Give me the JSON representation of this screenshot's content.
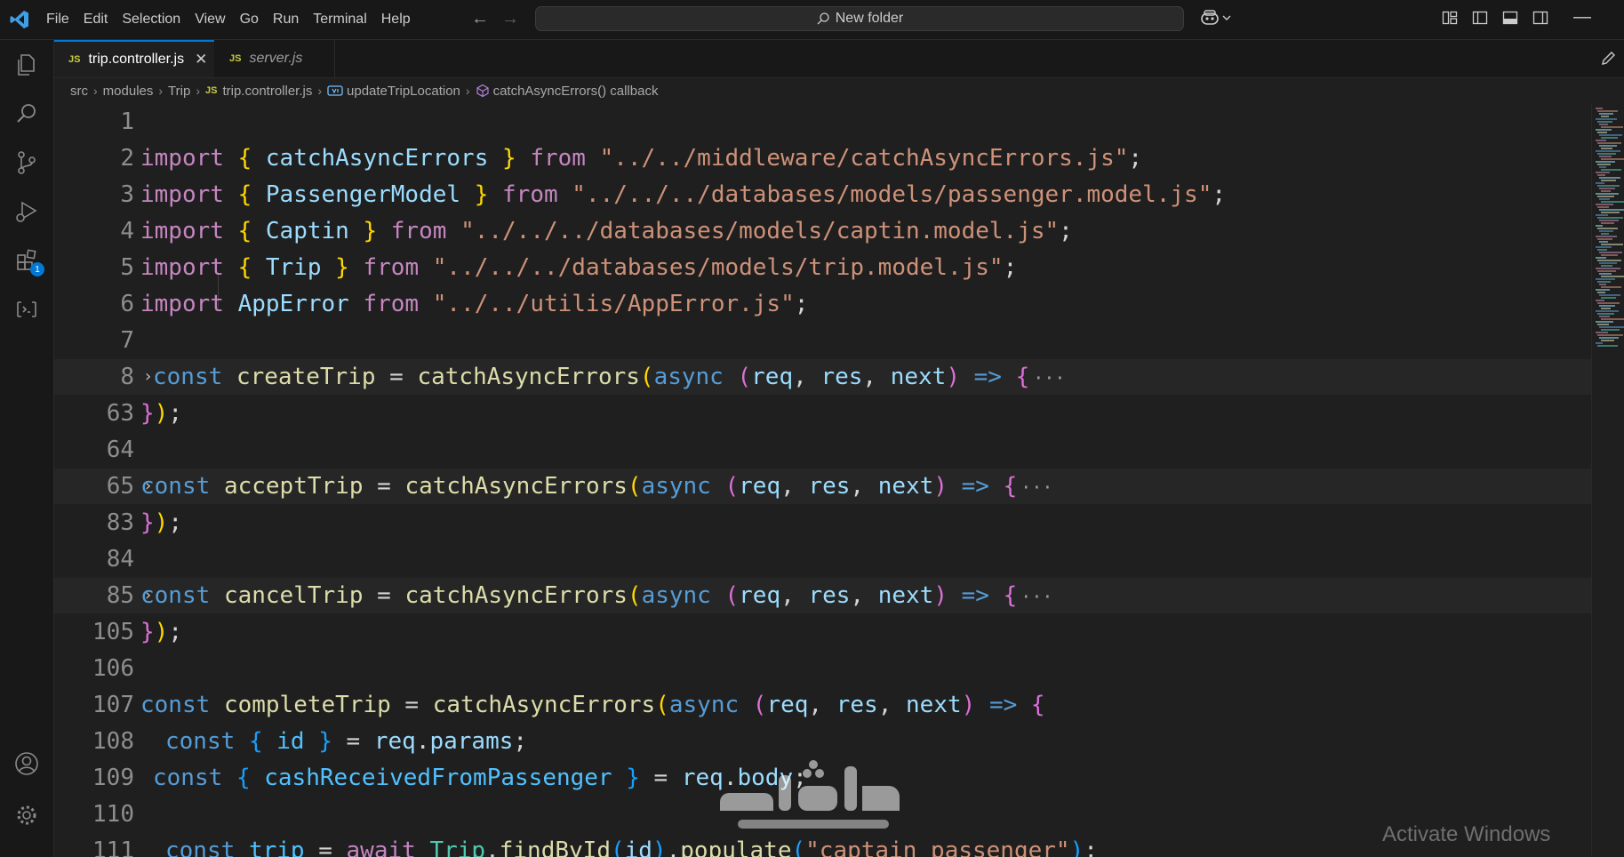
{
  "window": {
    "menu": [
      "File",
      "Edit",
      "Selection",
      "View",
      "Go",
      "Run",
      "Terminal",
      "Help"
    ],
    "command_center": "New folder",
    "minimize_glyph": "—"
  },
  "activity_bar": {
    "items": [
      "explorer-icon",
      "search-icon",
      "source-control-icon",
      "run-debug-icon",
      "extensions-icon",
      "remote-explorer-icon"
    ],
    "extensions_badge": "1",
    "bottom": [
      "accounts-icon",
      "settings-icon"
    ]
  },
  "tabs": [
    {
      "label": "trip.controller.js",
      "badge": "JS",
      "active": true,
      "close": "✕"
    },
    {
      "label": "server.js",
      "badge": "JS",
      "active": false
    }
  ],
  "breadcrumb": {
    "items": [
      "src",
      "modules",
      "Trip",
      "trip.controller.js",
      "updateTripLocation",
      "catchAsyncErrors() callback"
    ],
    "separator": "›",
    "file_badge": "JS"
  },
  "editor": {
    "line_numbers": [
      "1",
      "2",
      "3",
      "4",
      "5",
      "6",
      "7",
      "8",
      "63",
      "64",
      "65",
      "83",
      "84",
      "85",
      "105",
      "106",
      "107",
      "108",
      "109",
      "110",
      "111"
    ],
    "lines": [
      [],
      [
        [
          "kw",
          "import"
        ],
        [
          "pun",
          " "
        ],
        [
          "b1",
          "{"
        ],
        [
          "pun",
          " "
        ],
        [
          "var",
          "catchAsyncErrors"
        ],
        [
          "pun",
          " "
        ],
        [
          "b1",
          "}"
        ],
        [
          "pun",
          " "
        ],
        [
          "kw",
          "from"
        ],
        [
          "pun",
          " "
        ],
        [
          "str",
          "\"../../middleware/catchAsyncErrors.js\""
        ],
        [
          "pun",
          ";"
        ]
      ],
      [
        [
          "kw",
          "import"
        ],
        [
          "pun",
          " "
        ],
        [
          "b1",
          "{"
        ],
        [
          "pun",
          " "
        ],
        [
          "var",
          "PassengerModel"
        ],
        [
          "pun",
          " "
        ],
        [
          "b1",
          "}"
        ],
        [
          "pun",
          " "
        ],
        [
          "kw",
          "from"
        ],
        [
          "pun",
          " "
        ],
        [
          "str",
          "\"../../../databases/models/passenger.model.js\""
        ],
        [
          "pun",
          ";"
        ]
      ],
      [
        [
          "kw",
          "import"
        ],
        [
          "pun",
          " "
        ],
        [
          "b1",
          "{"
        ],
        [
          "pun",
          " "
        ],
        [
          "var",
          "Captin"
        ],
        [
          "pun",
          " "
        ],
        [
          "b1",
          "}"
        ],
        [
          "pun",
          " "
        ],
        [
          "kw",
          "from"
        ],
        [
          "pun",
          " "
        ],
        [
          "str",
          "\"../../../databases/models/captin.model.js\""
        ],
        [
          "pun",
          ";"
        ]
      ],
      [
        [
          "kw",
          "import"
        ],
        [
          "pun",
          " "
        ],
        [
          "b1",
          "{"
        ],
        [
          "pun",
          " "
        ],
        [
          "var",
          "Trip"
        ],
        [
          "pun",
          " "
        ],
        [
          "b1",
          "}"
        ],
        [
          "pun",
          " "
        ],
        [
          "kw",
          "from"
        ],
        [
          "pun",
          " "
        ],
        [
          "str",
          "\"../../../databases/models/trip.model.js\""
        ],
        [
          "pun",
          ";"
        ]
      ],
      [
        [
          "kw",
          "import"
        ],
        [
          "pun",
          " "
        ],
        [
          "var",
          "AppError"
        ],
        [
          "pun",
          " "
        ],
        [
          "kw",
          "from"
        ],
        [
          "pun",
          " "
        ],
        [
          "str",
          "\"../../utilis/AppError.js\""
        ],
        [
          "pun",
          ";"
        ]
      ],
      [],
      [
        [
          "st",
          "const"
        ],
        [
          "pun",
          " "
        ],
        [
          "fn",
          "createTrip"
        ],
        [
          "pun",
          " = "
        ],
        [
          "fn",
          "catchAsyncErrors"
        ],
        [
          "b1",
          "("
        ],
        [
          "st",
          "async"
        ],
        [
          "pun",
          " "
        ],
        [
          "b2",
          "("
        ],
        [
          "var",
          "req"
        ],
        [
          "pun",
          ", "
        ],
        [
          "var",
          "res"
        ],
        [
          "pun",
          ", "
        ],
        [
          "var",
          "next"
        ],
        [
          "b2",
          ")"
        ],
        [
          "pun",
          " "
        ],
        [
          "st",
          "=>"
        ],
        [
          "pun",
          " "
        ],
        [
          "b2",
          "{"
        ]
      ],
      [
        [
          "b2",
          "}"
        ],
        [
          "b1",
          ")"
        ],
        [
          "pun",
          ";"
        ]
      ],
      [],
      [
        [
          "st",
          "const"
        ],
        [
          "pun",
          " "
        ],
        [
          "fn",
          "acceptTrip"
        ],
        [
          "pun",
          " = "
        ],
        [
          "fn",
          "catchAsyncErrors"
        ],
        [
          "b1",
          "("
        ],
        [
          "st",
          "async"
        ],
        [
          "pun",
          " "
        ],
        [
          "b2",
          "("
        ],
        [
          "var",
          "req"
        ],
        [
          "pun",
          ", "
        ],
        [
          "var",
          "res"
        ],
        [
          "pun",
          ", "
        ],
        [
          "var",
          "next"
        ],
        [
          "b2",
          ")"
        ],
        [
          "pun",
          " "
        ],
        [
          "st",
          "=>"
        ],
        [
          "pun",
          " "
        ],
        [
          "b2",
          "{"
        ]
      ],
      [
        [
          "b2",
          "}"
        ],
        [
          "b1",
          ")"
        ],
        [
          "pun",
          ";"
        ]
      ],
      [],
      [
        [
          "st",
          "const"
        ],
        [
          "pun",
          " "
        ],
        [
          "fn",
          "cancelTrip"
        ],
        [
          "pun",
          " = "
        ],
        [
          "fn",
          "catchAsyncErrors"
        ],
        [
          "b1",
          "("
        ],
        [
          "st",
          "async"
        ],
        [
          "pun",
          " "
        ],
        [
          "b2",
          "("
        ],
        [
          "var",
          "req"
        ],
        [
          "pun",
          ", "
        ],
        [
          "var",
          "res"
        ],
        [
          "pun",
          ", "
        ],
        [
          "var",
          "next"
        ],
        [
          "b2",
          ")"
        ],
        [
          "pun",
          " "
        ],
        [
          "st",
          "=>"
        ],
        [
          "pun",
          " "
        ],
        [
          "b2",
          "{"
        ]
      ],
      [
        [
          "b2",
          "}"
        ],
        [
          "b1",
          ")"
        ],
        [
          "pun",
          ";"
        ]
      ],
      [],
      [
        [
          "st",
          "const"
        ],
        [
          "pun",
          " "
        ],
        [
          "fn",
          "completeTrip"
        ],
        [
          "pun",
          " = "
        ],
        [
          "fn",
          "catchAsyncErrors"
        ],
        [
          "b1",
          "("
        ],
        [
          "st",
          "async"
        ],
        [
          "pun",
          " "
        ],
        [
          "b2",
          "("
        ],
        [
          "var",
          "req"
        ],
        [
          "pun",
          ", "
        ],
        [
          "var",
          "res"
        ],
        [
          "pun",
          ", "
        ],
        [
          "var",
          "next"
        ],
        [
          "b2",
          ")"
        ],
        [
          "pun",
          " "
        ],
        [
          "st",
          "=>"
        ],
        [
          "pun",
          " "
        ],
        [
          "b2",
          "{"
        ]
      ],
      [
        [
          "st",
          "const"
        ],
        [
          "pun",
          " "
        ],
        [
          "b3",
          "{"
        ],
        [
          "pun",
          " "
        ],
        [
          "cvar",
          "id"
        ],
        [
          "pun",
          " "
        ],
        [
          "b3",
          "}"
        ],
        [
          "pun",
          " = "
        ],
        [
          "var",
          "req"
        ],
        [
          "pun",
          "."
        ],
        [
          "var",
          "params"
        ],
        [
          "pun",
          ";"
        ]
      ],
      [
        [
          "st",
          "const"
        ],
        [
          "pun",
          " "
        ],
        [
          "b3",
          "{"
        ],
        [
          "pun",
          " "
        ],
        [
          "cvar",
          "cashReceivedFromPassenger"
        ],
        [
          "pun",
          " "
        ],
        [
          "b3",
          "}"
        ],
        [
          "pun",
          " = "
        ],
        [
          "var",
          "req"
        ],
        [
          "pun",
          "."
        ],
        [
          "var",
          "body"
        ],
        [
          "pun",
          ";"
        ]
      ],
      [],
      [
        [
          "st",
          "const"
        ],
        [
          "pun",
          " "
        ],
        [
          "cvar",
          "trip"
        ],
        [
          "pun",
          " = "
        ],
        [
          "kw",
          "await"
        ],
        [
          "pun",
          " "
        ],
        [
          "cls",
          "Trip"
        ],
        [
          "pun",
          "."
        ],
        [
          "fn",
          "findById"
        ],
        [
          "b3",
          "("
        ],
        [
          "var",
          "id"
        ],
        [
          "b3",
          ")"
        ],
        [
          "pun",
          "."
        ],
        [
          "fn",
          "populate"
        ],
        [
          "b3",
          "("
        ],
        [
          "str",
          "\"captain passenger\""
        ],
        [
          "b3",
          ")"
        ],
        [
          "pun",
          ";"
        ]
      ]
    ],
    "folded": [
      false,
      false,
      false,
      false,
      false,
      false,
      false,
      true,
      false,
      false,
      true,
      false,
      false,
      true,
      false,
      false,
      false,
      false,
      false,
      false,
      false
    ],
    "fold_glyph": "›",
    "collapsed_glyph": "···"
  },
  "overlay": {
    "activate_windows": "Activate Windows"
  },
  "colors": {
    "accent": "#0078d4",
    "js_badge": "#cbcb41"
  }
}
